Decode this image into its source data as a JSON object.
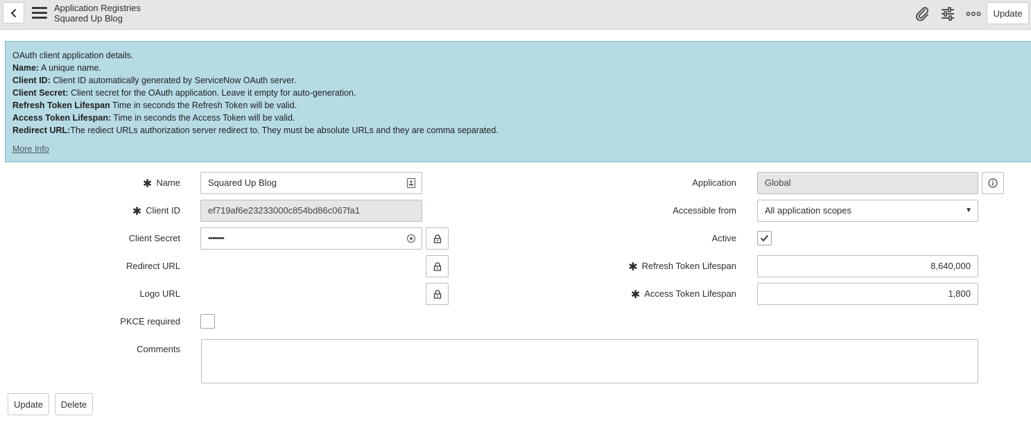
{
  "header": {
    "title": "Application Registries",
    "subtitle": "Squared Up Blog",
    "update_label": "Update"
  },
  "info": {
    "intro": "OAuth client application details.",
    "lines": [
      {
        "term": "Name:",
        "text": " A unique name."
      },
      {
        "term": "Client ID:",
        "text": " Client ID automatically generated by ServiceNow OAuth server."
      },
      {
        "term": "Client Secret:",
        "text": " Client secret for the OAuth application. Leave it empty for auto-generation."
      },
      {
        "term": "Refresh Token Lifespan",
        "text": " Time in seconds the Refresh Token will be valid."
      },
      {
        "term": "Access Token Lifespan:",
        "text": " Time in seconds the Access Token will be valid."
      },
      {
        "term": "Redirect URL:",
        "text": "The rediect URLs authorization server redirect to. They must be absolute URLs and they are comma separated."
      }
    ],
    "more_info": "More Info"
  },
  "form": {
    "required_mark": "✱",
    "name_label": "Name",
    "name_value": "Squared Up Blog",
    "client_id_label": "Client ID",
    "client_id_value": "ef719af6e23233000c854bd86c067fa1",
    "client_secret_label": "Client Secret",
    "client_secret_value": "••••••••",
    "redirect_url_label": "Redirect URL",
    "logo_url_label": "Logo URL",
    "pkce_label": "PKCE required",
    "pkce_checked": false,
    "comments_label": "Comments",
    "application_label": "Application",
    "application_value": "Global",
    "accessible_from_label": "Accessible from",
    "accessible_from_value": "All application scopes",
    "active_label": "Active",
    "active_checked": true,
    "refresh_label": "Refresh Token Lifespan",
    "refresh_value": "8,640,000",
    "access_label": "Access Token Lifespan",
    "access_value": "1,800"
  },
  "footer": {
    "update_label": "Update",
    "delete_label": "Delete"
  },
  "colors": {
    "info_bg": "#b6dbe4",
    "header_bg": "#e4e6e7"
  }
}
